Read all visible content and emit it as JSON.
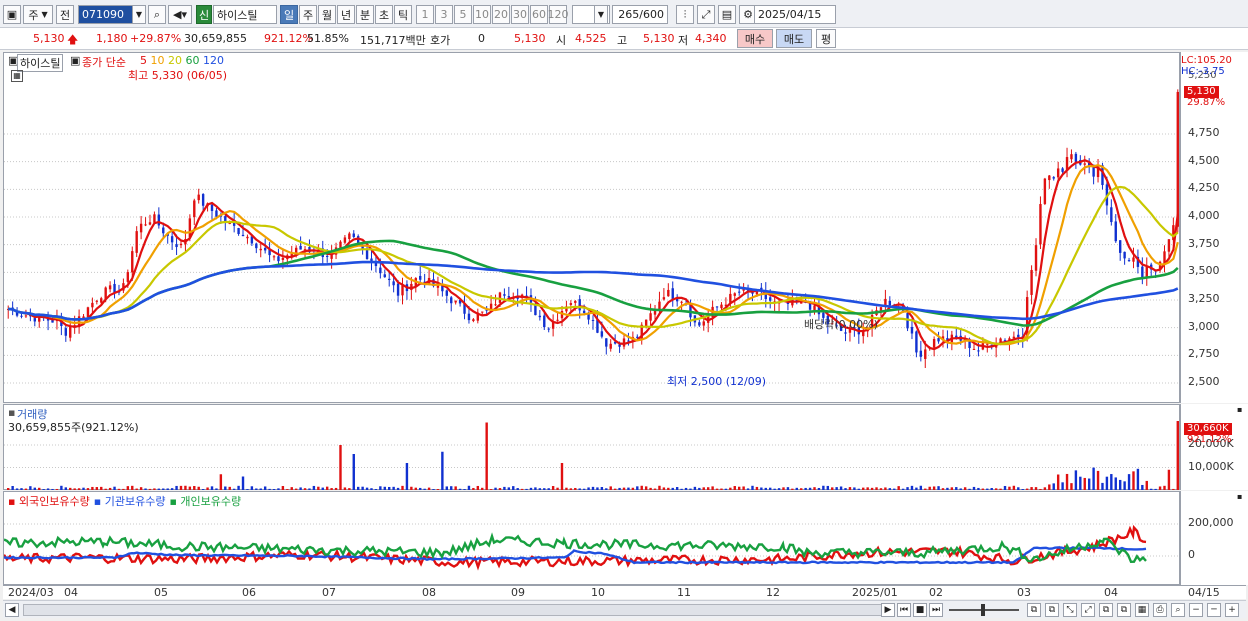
{
  "toolbar": {
    "period_label": "주",
    "prev_label": "전",
    "code": "071090",
    "stock_tag": "신",
    "stock_name": "하이스틸",
    "timeframes": [
      {
        "label": "일",
        "active": true
      },
      {
        "label": "주",
        "active": false
      },
      {
        "label": "월",
        "active": false
      },
      {
        "label": "년",
        "active": false
      },
      {
        "label": "분",
        "active": false
      },
      {
        "label": "초",
        "active": false
      },
      {
        "label": "틱",
        "active": false
      }
    ],
    "intervals": [
      "1",
      "3",
      "5",
      "10",
      "20",
      "30",
      "60",
      "120"
    ],
    "count": "265",
    "count_total": "/600",
    "date": "2025/04/15"
  },
  "quote": {
    "price": "5,130",
    "change": "1,180",
    "change_pct": "+29.87%",
    "volume": "30,659,855",
    "vol_ratio": "921.12%",
    "turnover_rate": "51.85%",
    "amount": "151,717백만",
    "hoga_label": "호가",
    "hoga_value": "0",
    "hoga_price": "5,130",
    "open_label": "시",
    "open": "4,525",
    "high_label": "고",
    "high": "5,130",
    "low_label": "저",
    "low": "4,340",
    "buy_label": "매수",
    "sell_label": "매도",
    "avg_label": "평"
  },
  "price_panel": {
    "title": "하이스틸",
    "ma_label": "종가 단순",
    "ma_periods": [
      "5",
      "10",
      "20",
      "60",
      "120"
    ],
    "ma_colors": [
      "#e01010",
      "#f0a000",
      "#c8c800",
      "#18a040",
      "#2050e0"
    ],
    "high_note": "최고 5,330 (06/05)",
    "low_note": "최저 2,500 (12/09)",
    "div_note": "배당락(0.00%)",
    "y_ticks": [
      "4,750",
      "4,500",
      "4,250",
      "4,000",
      "3,750",
      "3,500",
      "3,250",
      "3,000",
      "2,750",
      "2,500"
    ],
    "lc": "LC:105.20",
    "hc": "HC:-3.75",
    "cur_tag": "5,130",
    "cur_pct": "29.87%",
    "cut_tick": "5,250"
  },
  "volume_panel": {
    "title": "거래량",
    "value": "30,659,855주(921.12%)",
    "y_ticks": [
      "20,000K",
      "10,000K"
    ],
    "cur_tag": "30,660K",
    "cur_pct": "921.12%"
  },
  "holding_panel": {
    "series": [
      "외국인보유수량",
      "기관보유수량",
      "개인보유수량"
    ],
    "colors": [
      "#e01010",
      "#2050e0",
      "#18a040"
    ],
    "y_ticks": [
      "200,000",
      "0"
    ]
  },
  "x_axis": [
    "2024/03",
    "04",
    "05",
    "06",
    "07",
    "08",
    "09",
    "10",
    "11",
    "12",
    "2025/01",
    "02",
    "03",
    "04"
  ],
  "x_axis_right": "04/15",
  "colors": {
    "up": "#e01010",
    "down": "#1030d0",
    "accent": "#4a7ab8"
  }
}
